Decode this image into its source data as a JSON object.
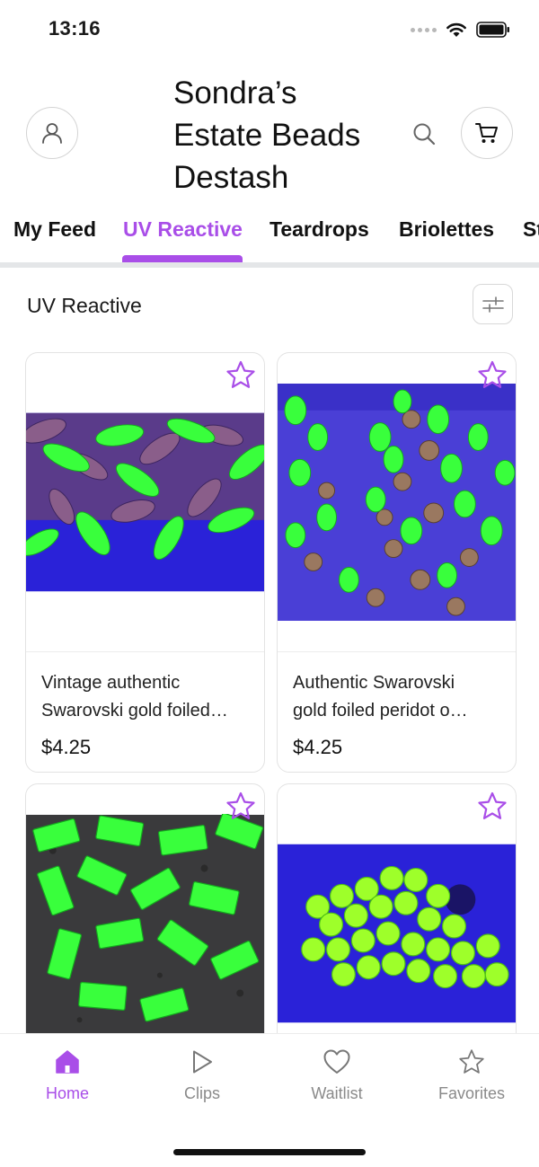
{
  "status_bar": {
    "time": "13:16"
  },
  "header": {
    "store_title_lines": [
      "Sondra’s",
      "Estate Beads",
      "Destash"
    ]
  },
  "tabs": [
    {
      "label": "My Feed",
      "active": false
    },
    {
      "label": "UV Reactive",
      "active": true
    },
    {
      "label": "Teardrops",
      "active": false
    },
    {
      "label": "Briolettes",
      "active": false
    },
    {
      "label": "St",
      "active": false
    }
  ],
  "section": {
    "title": "UV Reactive"
  },
  "products": [
    {
      "title_line1": "Vintage authentic",
      "title_line2": "Swarovski gold foiled…",
      "price": "$4.25",
      "image": "uv-navette-crystals"
    },
    {
      "title_line1": "Authentic Swarovski",
      "title_line2": "gold foiled peridot o…",
      "price": "$4.25",
      "image": "uv-oval-crystals"
    },
    {
      "title_line1": "",
      "title_line2": "",
      "price": "",
      "image": "uv-baguette-crystals"
    },
    {
      "title_line1": "",
      "title_line2": "",
      "price": "",
      "image": "uv-round-crystals"
    }
  ],
  "bottom_nav": [
    {
      "label": "Home",
      "icon": "home-icon",
      "active": true
    },
    {
      "label": "Clips",
      "icon": "play-icon",
      "active": false
    },
    {
      "label": "Waitlist",
      "icon": "heart-icon",
      "active": false
    },
    {
      "label": "Favorites",
      "icon": "star-icon",
      "active": false
    }
  ],
  "colors": {
    "accent": "#a94ee8",
    "uv_green": "#39ff3c",
    "uv_blue": "#2a22d8"
  }
}
